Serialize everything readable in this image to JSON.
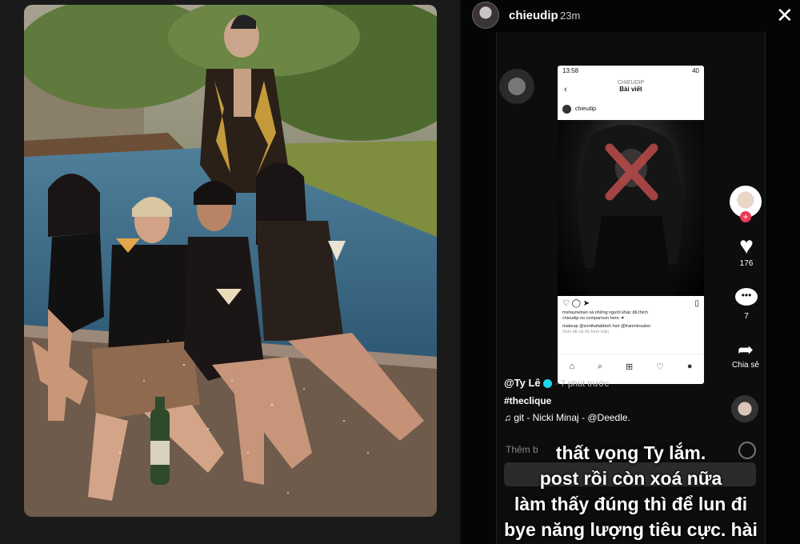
{
  "story": {
    "username": "chieudip",
    "time": "23m",
    "close": "✕"
  },
  "instagram": {
    "status_time": "13:58",
    "status_right": "40",
    "header_small": "CHIEUDIP",
    "header_title": "Bài viết",
    "post_user": "chieudip",
    "likes_text": "mshaynetran và những người khác đã thích",
    "caption": "chieudip no comparison here. ♥",
    "credits": "makeup @sonthafabbish hair @franminsalon",
    "comments": "Xem tất cả 66 bình luận"
  },
  "tiktok": {
    "likes": "176",
    "comments": "7",
    "share_label": "Chia sẻ",
    "author": "@Ty Lê",
    "posted": "· 7 phút trước",
    "hashtag": "#theclique",
    "music": "git - Nicki Minaj - @Deedle.",
    "comment_placeholder": "Thêm b"
  },
  "caption_lines": [
    "thất vọng Ty lắm.",
    "post rồi còn xoá nữa",
    "làm thấy đúng thì để lun đi",
    "bye năng lượng tiêu cực. hài"
  ]
}
